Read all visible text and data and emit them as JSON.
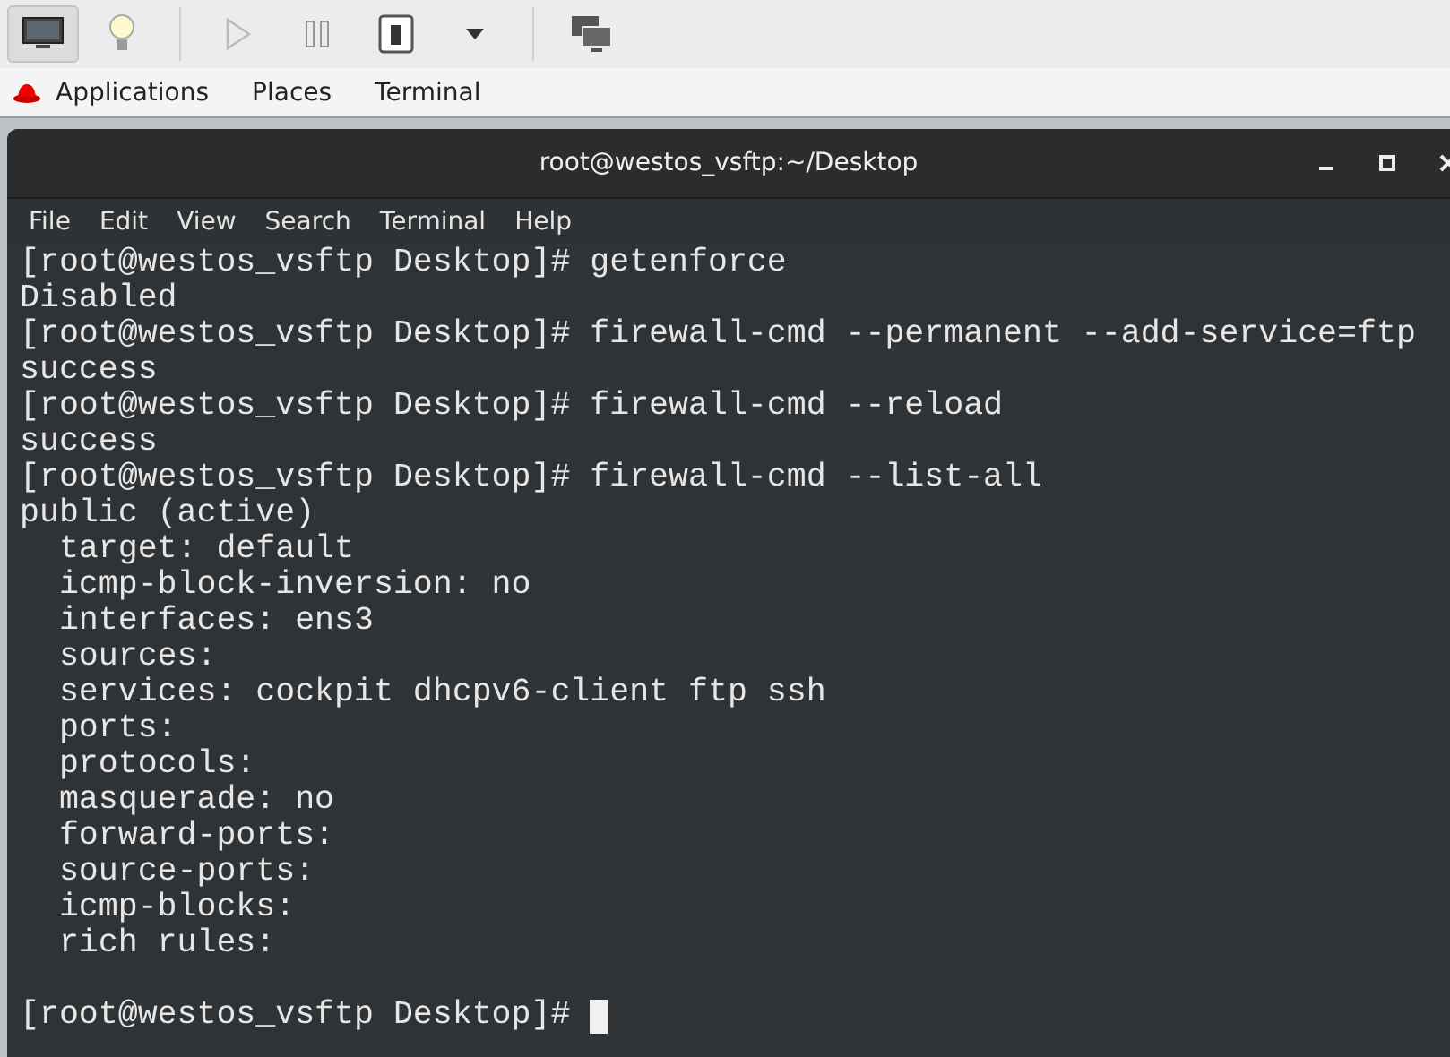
{
  "toolbar": [
    {
      "kind": "display",
      "selected": true
    },
    {
      "kind": "bulb",
      "selected": false
    },
    {
      "kind": "play",
      "selected": false
    },
    {
      "kind": "pause",
      "selected": false
    },
    {
      "kind": "switch",
      "selected": false
    },
    {
      "kind": "dropdown",
      "selected": false
    },
    {
      "kind": "screens",
      "selected": false
    }
  ],
  "top_bar": {
    "menus": [
      "Applications",
      "Places",
      "Terminal"
    ]
  },
  "window": {
    "title": "root@westos_vsftp:~/Desktop"
  },
  "menu_bar": [
    "File",
    "Edit",
    "View",
    "Search",
    "Terminal",
    "Help"
  ],
  "terminal": {
    "lines": [
      "[root@westos_vsftp Desktop]# getenforce",
      "Disabled",
      "[root@westos_vsftp Desktop]# firewall-cmd --permanent --add-service=ftp",
      "success",
      "[root@westos_vsftp Desktop]# firewall-cmd --reload",
      "success",
      "[root@westos_vsftp Desktop]# firewall-cmd --list-all",
      "public (active)",
      "  target: default",
      "  icmp-block-inversion: no",
      "  interfaces: ens3",
      "  sources: ",
      "  services: cockpit dhcpv6-client ftp ssh",
      "  ports: ",
      "  protocols: ",
      "  masquerade: no",
      "  forward-ports: ",
      "  source-ports: ",
      "  icmp-blocks: ",
      "  rich rules: "
    ],
    "prompt": "[root@westos_vsftp Desktop]# "
  }
}
